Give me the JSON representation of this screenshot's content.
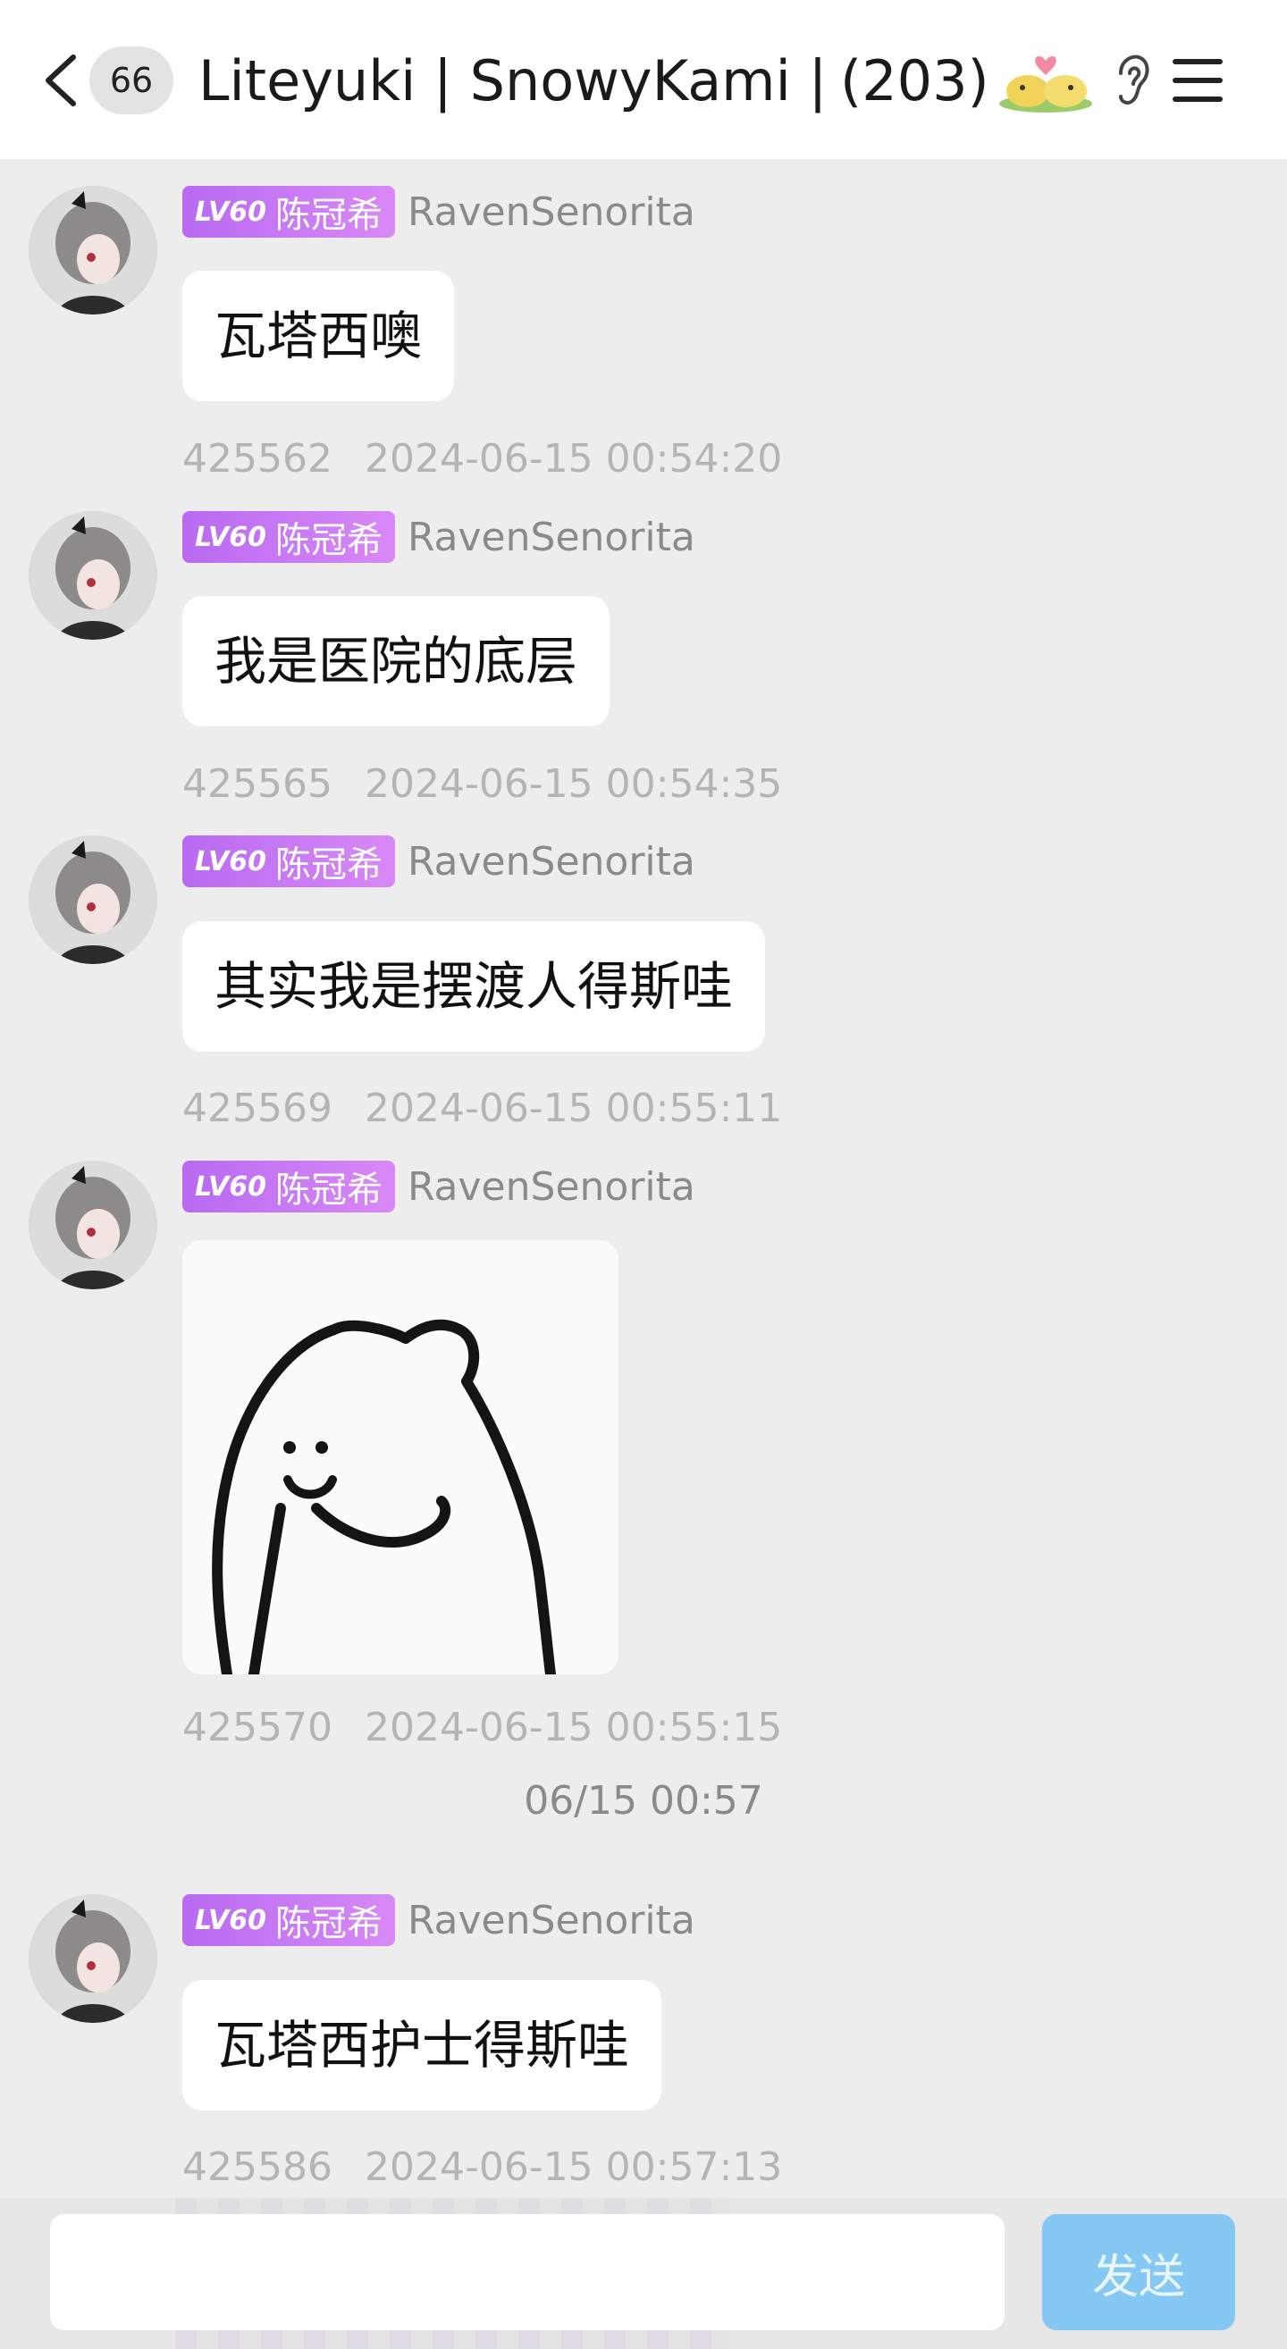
{
  "header": {
    "unread_count": "66",
    "title": "Liteyuki | SnowyKami |…",
    "member_count": "(203)"
  },
  "messages": [
    {
      "level": "LV60",
      "title_badge": "陈冠希",
      "sender": "RavenSenorita",
      "text": "瓦塔西噢",
      "id": "425562",
      "time": "2024-06-15 00:54:20"
    },
    {
      "level": "LV60",
      "title_badge": "陈冠希",
      "sender": "RavenSenorita",
      "text": "我是医院的底层",
      "id": "425565",
      "time": "2024-06-15 00:54:35"
    },
    {
      "level": "LV60",
      "title_badge": "陈冠希",
      "sender": "RavenSenorita",
      "text": "其实我是摆渡人得斯哇",
      "id": "425569",
      "time": "2024-06-15 00:55:11"
    },
    {
      "level": "LV60",
      "title_badge": "陈冠希",
      "sender": "RavenSenorita",
      "sticker": "bear-sticker",
      "id": "425570",
      "time": "2024-06-15 00:55:15"
    },
    {
      "level": "LV60",
      "title_badge": "陈冠希",
      "sender": "RavenSenorita",
      "text": "瓦塔西护士得斯哇",
      "id": "425586",
      "time": "2024-06-15 00:57:13"
    }
  ],
  "time_divider": "06/15 00:57",
  "composer": {
    "input_value": "",
    "send_label": "发送"
  },
  "colors": {
    "badge": "#b86af2",
    "send_button": "#86c8f4",
    "background": "#ededed"
  }
}
